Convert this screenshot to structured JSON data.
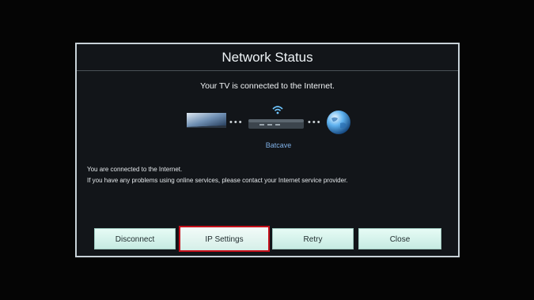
{
  "dialog": {
    "title": "Network Status",
    "headline": "Your TV is connected to the Internet.",
    "network_name": "Batcave",
    "messages": [
      "You are connected to the Internet.",
      "If you have any problems using online services, please contact your Internet service provider."
    ],
    "icons": {
      "tv": "tv-icon",
      "router": "router-icon",
      "wifi": "wifi-icon",
      "globe": "globe-icon"
    },
    "buttons": {
      "disconnect": "Disconnect",
      "ip_settings": "IP Settings",
      "retry": "Retry",
      "close": "Close"
    },
    "focused_button": "ip_settings",
    "colors": {
      "focus_outline": "#c5101b",
      "network_name": "#7fb0e6",
      "button_bg": "#d6f3ec"
    }
  }
}
